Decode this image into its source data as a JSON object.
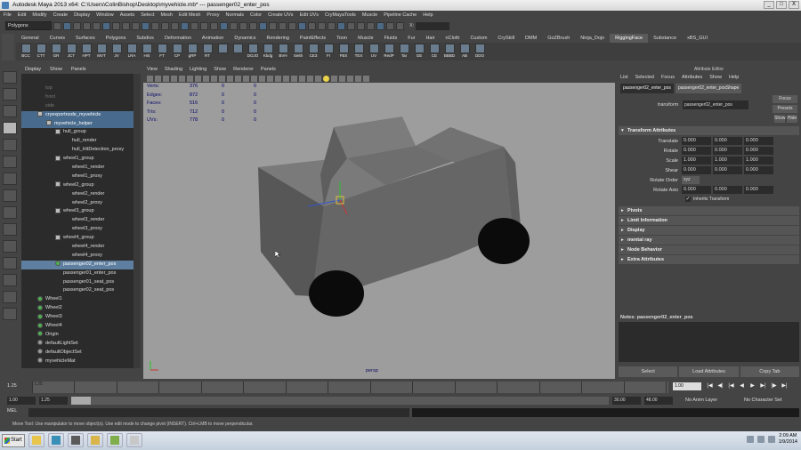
{
  "window": {
    "title": "Autodesk Maya 2013 x64: C:\\Users\\ColinBishop\\Desktop\\myvehicle.mb*  ---  passenger02_enter_pos",
    "controls": [
      "_",
      "□",
      "X"
    ]
  },
  "menubar": [
    "File",
    "Edit",
    "Modify",
    "Create",
    "Display",
    "Window",
    "Assets",
    "Select",
    "Mesh",
    "Edit Mesh",
    "Proxy",
    "Normals",
    "Color",
    "Create UVs",
    "Edit UVs",
    "CryMayaTools",
    "Muscle",
    "Pipeline Cache",
    "Help"
  ],
  "status_line": {
    "mode": "Polygons",
    "coord_label": "X:"
  },
  "shelf": {
    "tabs": [
      "General",
      "Curves",
      "Surfaces",
      "Polygons",
      "Subdivs",
      "Deformation",
      "Animation",
      "Dynamics",
      "Rendering",
      "PaintEffects",
      "Toon",
      "Muscle",
      "Fluids",
      "Fur",
      "Hair",
      "nCloth",
      "Custom",
      "CrySkill",
      "DMM",
      "GoZBrush",
      "Ninja_Dojo",
      "RiggingFace",
      "Substance",
      "xBS_GUI"
    ],
    "active_tab": "RiggingFace",
    "buttons": [
      "BCC",
      "CTT",
      "GR",
      "JCT",
      "HPT",
      "MVT",
      "JV",
      "LRA",
      "Hnt",
      "FT",
      "CP",
      "gRP",
      "RT",
      "",
      "",
      "DOJO",
      "Kbdg",
      "BVH",
      "Seith",
      "CE3",
      "FI",
      "FBX",
      "TEX",
      "UV",
      "RedP",
      "Tar",
      "GE",
      "CE",
      "BBBD",
      "AB",
      "DDO"
    ]
  },
  "outliner": {
    "menu": [
      "Display",
      "Show",
      "Panels"
    ],
    "items": [
      {
        "label": "top",
        "depth": 0,
        "style": "dim",
        "marker": "none"
      },
      {
        "label": "front",
        "depth": 0,
        "style": "dim",
        "marker": "none"
      },
      {
        "label": "side",
        "depth": 0,
        "style": "dim",
        "marker": "none"
      },
      {
        "label": "cryexportnode_myvehicle",
        "depth": 0,
        "style": "hl2",
        "marker": "box"
      },
      {
        "label": "myvehicle_helper",
        "depth": 1,
        "style": "hl2",
        "marker": "box"
      },
      {
        "label": "hull_group",
        "depth": 2,
        "style": "",
        "marker": "box"
      },
      {
        "label": "hull_render",
        "depth": 3,
        "style": "",
        "marker": "none"
      },
      {
        "label": "hull_HitDetection_proxy",
        "depth": 3,
        "style": "",
        "marker": "none"
      },
      {
        "label": "wheel1_group",
        "depth": 2,
        "style": "",
        "marker": "box"
      },
      {
        "label": "wheel1_render",
        "depth": 3,
        "style": "",
        "marker": "none"
      },
      {
        "label": "wheel1_proxy",
        "depth": 3,
        "style": "",
        "marker": "none"
      },
      {
        "label": "wheel2_group",
        "depth": 2,
        "style": "",
        "marker": "box"
      },
      {
        "label": "wheel2_render",
        "depth": 3,
        "style": "",
        "marker": "none"
      },
      {
        "label": "wheel2_proxy",
        "depth": 3,
        "style": "",
        "marker": "none"
      },
      {
        "label": "wheel3_group",
        "depth": 2,
        "style": "",
        "marker": "box"
      },
      {
        "label": "wheel3_render",
        "depth": 3,
        "style": "",
        "marker": "none"
      },
      {
        "label": "wheel3_proxy",
        "depth": 3,
        "style": "",
        "marker": "none"
      },
      {
        "label": "wheel4_group",
        "depth": 2,
        "style": "",
        "marker": "box"
      },
      {
        "label": "wheel4_render",
        "depth": 3,
        "style": "",
        "marker": "none"
      },
      {
        "label": "wheel4_proxy",
        "depth": 3,
        "style": "",
        "marker": "none"
      },
      {
        "label": "passenger02_enter_pos",
        "depth": 2,
        "style": "hl",
        "marker": "joint"
      },
      {
        "label": "passenger01_enter_pos",
        "depth": 2,
        "style": "",
        "marker": "none"
      },
      {
        "label": "passenger01_seat_pos",
        "depth": 2,
        "style": "",
        "marker": "none"
      },
      {
        "label": "passenger02_seat_pos",
        "depth": 2,
        "style": "",
        "marker": "none"
      },
      {
        "label": "Wheel1",
        "depth": 0,
        "style": "",
        "marker": "joint"
      },
      {
        "label": "Wheel2",
        "depth": 0,
        "style": "",
        "marker": "joint"
      },
      {
        "label": "Wheel3",
        "depth": 0,
        "style": "",
        "marker": "joint"
      },
      {
        "label": "Wheel4",
        "depth": 0,
        "style": "",
        "marker": "joint"
      },
      {
        "label": "Origin",
        "depth": 0,
        "style": "",
        "marker": "joint"
      },
      {
        "label": "defaultLightSet",
        "depth": 0,
        "style": "",
        "marker": "set"
      },
      {
        "label": "defaultObjectSet",
        "depth": 0,
        "style": "",
        "marker": "set"
      },
      {
        "label": "myvehicleMat",
        "depth": 0,
        "style": "",
        "marker": "set"
      }
    ]
  },
  "viewport": {
    "menu": [
      "View",
      "Shading",
      "Lighting",
      "Show",
      "Renderer",
      "Panels"
    ],
    "hud": [
      {
        "k": "Verts:",
        "v": [
          "376",
          "0",
          "0"
        ]
      },
      {
        "k": "Edges:",
        "v": [
          "872",
          "0",
          "0"
        ]
      },
      {
        "k": "Faces:",
        "v": [
          "516",
          "0",
          "0"
        ]
      },
      {
        "k": "Tris:",
        "v": [
          "712",
          "0",
          "0"
        ]
      },
      {
        "k": "UVs:",
        "v": [
          "778",
          "0",
          "0"
        ]
      }
    ],
    "camera": "persp",
    "colors": {
      "background": "#9d9d9d",
      "body": "#6d6d6d",
      "wheels": "#0b0b0b"
    }
  },
  "attribute_editor": {
    "title": "Attribute Editor",
    "menu": [
      "List",
      "Selected",
      "Focus",
      "Attributes",
      "Show",
      "Help"
    ],
    "tabs": [
      "passenger02_enter_pos",
      "passenger02_enter_posShape"
    ],
    "transform_label": "transform",
    "transform_value": "passenger02_enter_pos",
    "buttons": [
      "Focus",
      "Presets",
      "Show",
      "Hide"
    ],
    "section_transform": "Transform Attributes",
    "attrs": [
      {
        "label": "Translate",
        "values": [
          "0.000",
          "0.000",
          "0.000"
        ]
      },
      {
        "label": "Rotate",
        "values": [
          "0.000",
          "0.000",
          "0.000"
        ]
      },
      {
        "label": "Scale",
        "values": [
          "1.000",
          "1.000",
          "1.000"
        ]
      },
      {
        "label": "Shear",
        "values": [
          "0.000",
          "0.000",
          "0.000"
        ]
      }
    ],
    "rotate_order_label": "Rotate Order",
    "rotate_order": "xyz",
    "rotate_axis_label": "Rotate Axis",
    "rotate_axis": [
      "0.000",
      "0.000",
      "0.000"
    ],
    "inherits_label": "Inherits Transform",
    "sections": [
      "Pivots",
      "Limit Information",
      "Display",
      "mental ray",
      "Node Behavior",
      "Extra Attributes"
    ],
    "notes": "Notes:  passenger02_enter_pos",
    "bottom_buttons": [
      "Select",
      "Load Attributes",
      "Copy Tab"
    ]
  },
  "timeline": {
    "current_label": "1.25",
    "ticks": [
      "1.25",
      "",
      "",
      "",
      "",
      "",
      "",
      "",
      "",
      "",
      "",
      "",
      "",
      "",
      "",
      ""
    ],
    "current_field": "1.00",
    "playback": [
      "|◀",
      "◀|",
      "|◀",
      "◀",
      "▶",
      "▶|",
      "|▶",
      "▶|"
    ]
  },
  "range": {
    "start": "1.00",
    "inner_start": "1.25",
    "handle_label": "1.25",
    "end_inner": "30.00",
    "end": "48.00",
    "anim_layer": "No Anim Layer",
    "char_set": "No Character Set"
  },
  "commandline": {
    "lang": "MEL"
  },
  "helpline": "Move Tool: Use manipulator to move object(s). Use edit mode to change pivot (INSERT). Ctrl+LMB to move perpendicular.",
  "taskbar": {
    "start": "Start",
    "clock_time": "2:09 AM",
    "clock_date": "1/9/2014",
    "apps": [
      {
        "name": "explorer-icon",
        "color": "#e8c54d"
      },
      {
        "name": "maya-icon",
        "color": "#3a8fb7"
      },
      {
        "name": "media-icon",
        "color": "#5a5a5a"
      },
      {
        "name": "folder-icon",
        "color": "#d9b54a"
      },
      {
        "name": "notes-icon",
        "color": "#7fae4b"
      },
      {
        "name": "paint-icon",
        "color": "#c8c8c8"
      }
    ]
  }
}
